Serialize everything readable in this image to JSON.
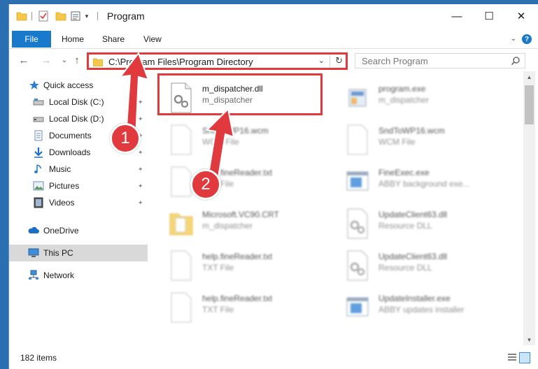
{
  "window": {
    "title": "Program",
    "minimize_glyph": "—",
    "maximize_glyph": "☐",
    "close_glyph": "✕"
  },
  "ribbon": {
    "tabs": [
      "File",
      "Home",
      "Share",
      "View"
    ],
    "expand_glyph": "⌄",
    "help_glyph": "?"
  },
  "nav": {
    "back_glyph": "←",
    "forward_glyph": "→",
    "recent_glyph": "⌄",
    "up_glyph": "↑",
    "address": "C:\\Program Files\\Program Directory",
    "dropdown_glyph": "⌄",
    "refresh_glyph": "↻",
    "search_placeholder": "Search Program"
  },
  "sidebar": {
    "items": [
      {
        "label": "Quick access",
        "icon": "star-icon",
        "pinned": false
      },
      {
        "label": "Local Disk (C:)",
        "icon": "drive-icon",
        "pinned": true
      },
      {
        "label": "Local Disk (D:)",
        "icon": "drive-icon",
        "pinned": true
      },
      {
        "label": "Documents",
        "icon": "documents-icon",
        "pinned": true
      },
      {
        "label": "Downloads",
        "icon": "download-icon",
        "pinned": true
      },
      {
        "label": "Music",
        "icon": "music-icon",
        "pinned": true
      },
      {
        "label": "Pictures",
        "icon": "pictures-icon",
        "pinned": true
      },
      {
        "label": "Videos",
        "icon": "videos-icon",
        "pinned": true
      },
      {
        "label": "OneDrive",
        "icon": "cloud-icon",
        "pinned": false
      },
      {
        "label": "This PC",
        "icon": "computer-icon",
        "pinned": false,
        "selected": true
      },
      {
        "label": "Network",
        "icon": "network-icon",
        "pinned": false
      }
    ],
    "pin_glyph": "📌"
  },
  "files": [
    {
      "name": "m_dispatcher.dll",
      "type": "m_dispatcher",
      "icon": "dll-icon",
      "blurred": false
    },
    {
      "name": "program.exe",
      "type": "m_dispatcher",
      "icon": "exe-icon",
      "blurred": true
    },
    {
      "name": "SndToWP16.wcm",
      "type": "WCM File",
      "icon": "blank-file-icon",
      "blurred": true
    },
    {
      "name": "SndToWP16.wcm",
      "type": "WCM File",
      "icon": "blank-file-icon",
      "blurred": true
    },
    {
      "name": "help.fineReader.txt",
      "type": "TXT File",
      "icon": "blank-file-icon",
      "blurred": true
    },
    {
      "name": "FineExec.exe",
      "type": "ABBY background exe...",
      "icon": "window-app-icon",
      "blurred": true
    },
    {
      "name": "Microsoft.VC90.CRT",
      "type": "m_dispatcher",
      "icon": "folder-icon",
      "blurred": true
    },
    {
      "name": "UpdateClient63.dll",
      "type": "Resource DLL",
      "icon": "dll-icon",
      "blurred": true
    },
    {
      "name": "help.fineReader.txt",
      "type": "TXT File",
      "icon": "blank-file-icon",
      "blurred": true
    },
    {
      "name": "UpdateClient63.dll",
      "type": "Resource DLL",
      "icon": "dll-icon",
      "blurred": true
    },
    {
      "name": "help.fineReader.txt",
      "type": "TXT File",
      "icon": "blank-file-icon",
      "blurred": true
    },
    {
      "name": "UpdateInstaller.exe",
      "type": "ABBY updates installer",
      "icon": "window-app-icon",
      "blurred": true
    }
  ],
  "annotations": {
    "badge_1": "1",
    "badge_2": "2",
    "accent_color": "#e0393e"
  },
  "scrollbar": {
    "up_glyph": "▲",
    "down_glyph": "▼"
  },
  "status": {
    "item_count": "182 items"
  }
}
